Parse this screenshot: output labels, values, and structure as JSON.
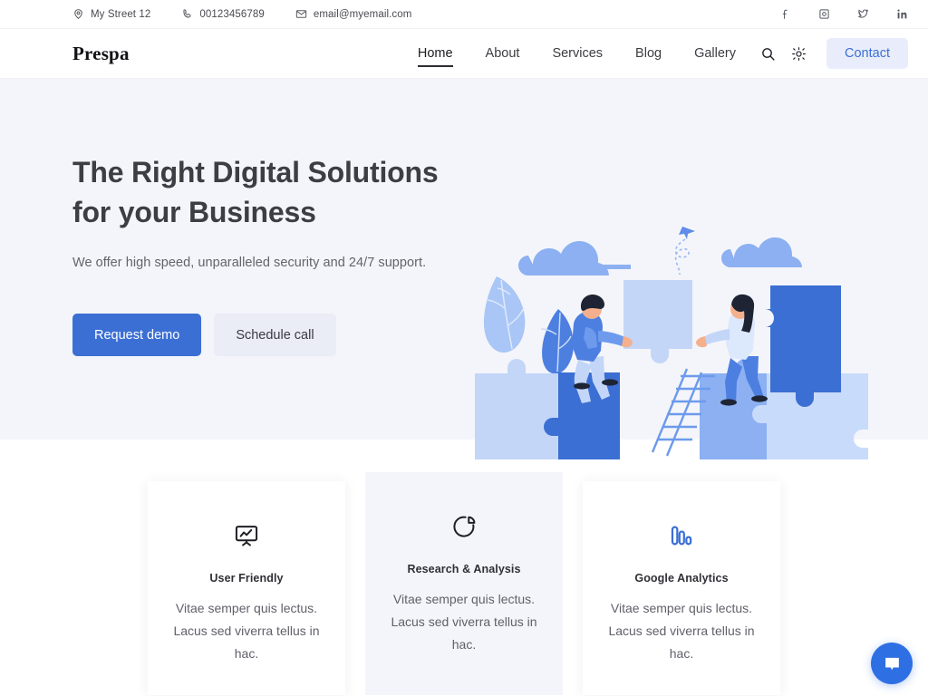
{
  "topbar": {
    "contacts": [
      {
        "icon": "location-pin-icon",
        "text": "My Street 12"
      },
      {
        "icon": "phone-icon",
        "text": "00123456789"
      },
      {
        "icon": "envelope-icon",
        "text": "email@myemail.com"
      }
    ],
    "social": [
      {
        "icon": "facebook-icon",
        "name": "Facebook"
      },
      {
        "icon": "instagram-icon",
        "name": "Instagram"
      },
      {
        "icon": "twitter-icon",
        "name": "Twitter"
      },
      {
        "icon": "linkedin-icon",
        "name": "LinkedIn"
      }
    ]
  },
  "nav": {
    "logo": "Prespa",
    "links": [
      {
        "label": "Home",
        "active": true
      },
      {
        "label": "About",
        "active": false
      },
      {
        "label": "Services",
        "active": false
      },
      {
        "label": "Blog",
        "active": false
      },
      {
        "label": "Gallery",
        "active": false
      }
    ],
    "search_icon": "search-icon",
    "theme_icon": "sun-icon",
    "contact_label": "Contact"
  },
  "hero": {
    "title_line1": "The Right Digital Solutions",
    "title_line2": "for your Business",
    "subtitle": "We offer high speed, unparalleled security and 24/7 support.",
    "primary_button": "Request demo",
    "secondary_button": "Schedule call",
    "illustration": "teamwork-puzzle-illustration"
  },
  "features": [
    {
      "icon": "presentation-chart-icon",
      "title": "User Friendly",
      "text": "Vitae semper quis lectus. Lacus sed viverra tellus in hac.",
      "shaded": false
    },
    {
      "icon": "pie-chart-icon",
      "title": "Research & Analysis",
      "text": "Vitae semper quis lectus. Lacus sed viverra tellus in hac.",
      "shaded": true
    },
    {
      "icon": "analytics-bars-icon",
      "title": "Google Analytics",
      "text": "Vitae semper quis lectus. Lacus sed viverra tellus in hac.",
      "shaded": false
    }
  ],
  "chat": {
    "icon": "chat-bubble-icon",
    "label": "Chat"
  },
  "colors": {
    "accent_blue": "#3b6fd4",
    "accent_soft": "#e9edfb",
    "hero_bg": "#f4f5fa",
    "heading": "#3d3d44",
    "body_text": "#60606a",
    "chat_blue": "#2f6fe4",
    "illustration_dark_blue": "#3b6fd4",
    "illustration_mid_blue": "#7fa6ef",
    "illustration_light_blue": "#c3d6f8",
    "illustration_pale_blue": "#d9e6fb"
  }
}
